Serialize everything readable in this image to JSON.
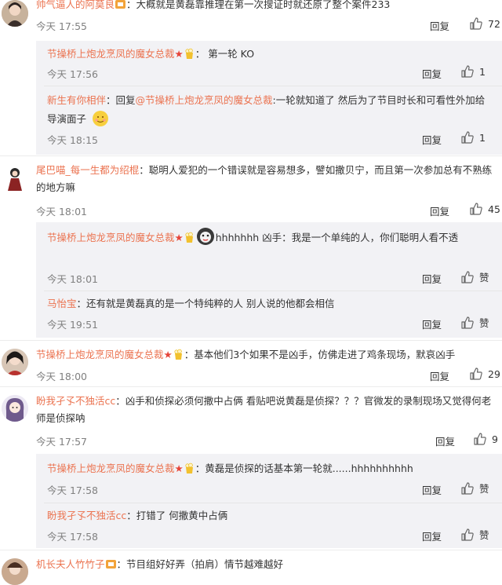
{
  "reply_label": "回复",
  "like_word": "赞",
  "comments": [
    {
      "user": "帅气逼人的阿莫良",
      "text": "：大概就是黄磊靠推理在第一次搜证时就还原了整个案件233",
      "time": "今天 17:55",
      "likes": "72"
    },
    {
      "user": "尾巴喵_每一生都为绍棍",
      "text": "：聪明人爱犯的一个错误就是容易想多，譬如撒贝宁，而且第一次参加总有不熟练的地方嘛",
      "time": "今天 18:01",
      "likes": "45"
    },
    {
      "user": "节操桥上炮龙烹凤的魔女总裁",
      "text": "：基本他们3个如果不是凶手，仿佛走进了鸡条现场，默哀凶手",
      "time": "今天 18:00",
      "likes": "29"
    },
    {
      "user": "盼我孑孓不独活cc",
      "text": "：凶手和侦探必须何撒中占俩 看贴吧说黄磊是侦探？？？官微发的录制现场又觉得何老师是侦探呐",
      "time": "今天 17:57",
      "likes": "9"
    },
    {
      "user": "机长夫人竹竹子",
      "text": "：节目组好好弄（拍肩）情节越难越好"
    }
  ],
  "replies": [
    {
      "user": "节操桥上炮龙烹凤的魔女总裁",
      "text": "： 第一轮 KO",
      "time": "今天 17:56",
      "likes": "1"
    },
    {
      "user": "新生有你相伴",
      "prefix": "：回复",
      "mention": "@节操桥上炮龙烹凤的魔女总裁",
      "text": ":一轮就知道了 然后为了节目时长和可看性外加给导演面子",
      "time": "今天 18:15",
      "likes": "1"
    },
    {
      "user": "节操桥上炮龙烹凤的魔女总裁",
      "text": "hhhhhhh 凶手：我是一个单纯的人，你们聪明人看不透",
      "time": "今天 18:01"
    },
    {
      "user": "马怡宝",
      "text": "：还有就是黄磊真的是一个特纯粹的人  别人说的他都会相信",
      "time": "今天 19:51"
    },
    {
      "user": "节操桥上炮龙烹凤的魔女总裁",
      "text": "：黄磊是侦探的话基本第一轮就......hhhhhhhhhh",
      "time": "今天 17:58"
    },
    {
      "user": "盼我孑孓不独活cc",
      "text": "：打错了 何撒黄中占俩",
      "time": "今天 17:58"
    }
  ]
}
